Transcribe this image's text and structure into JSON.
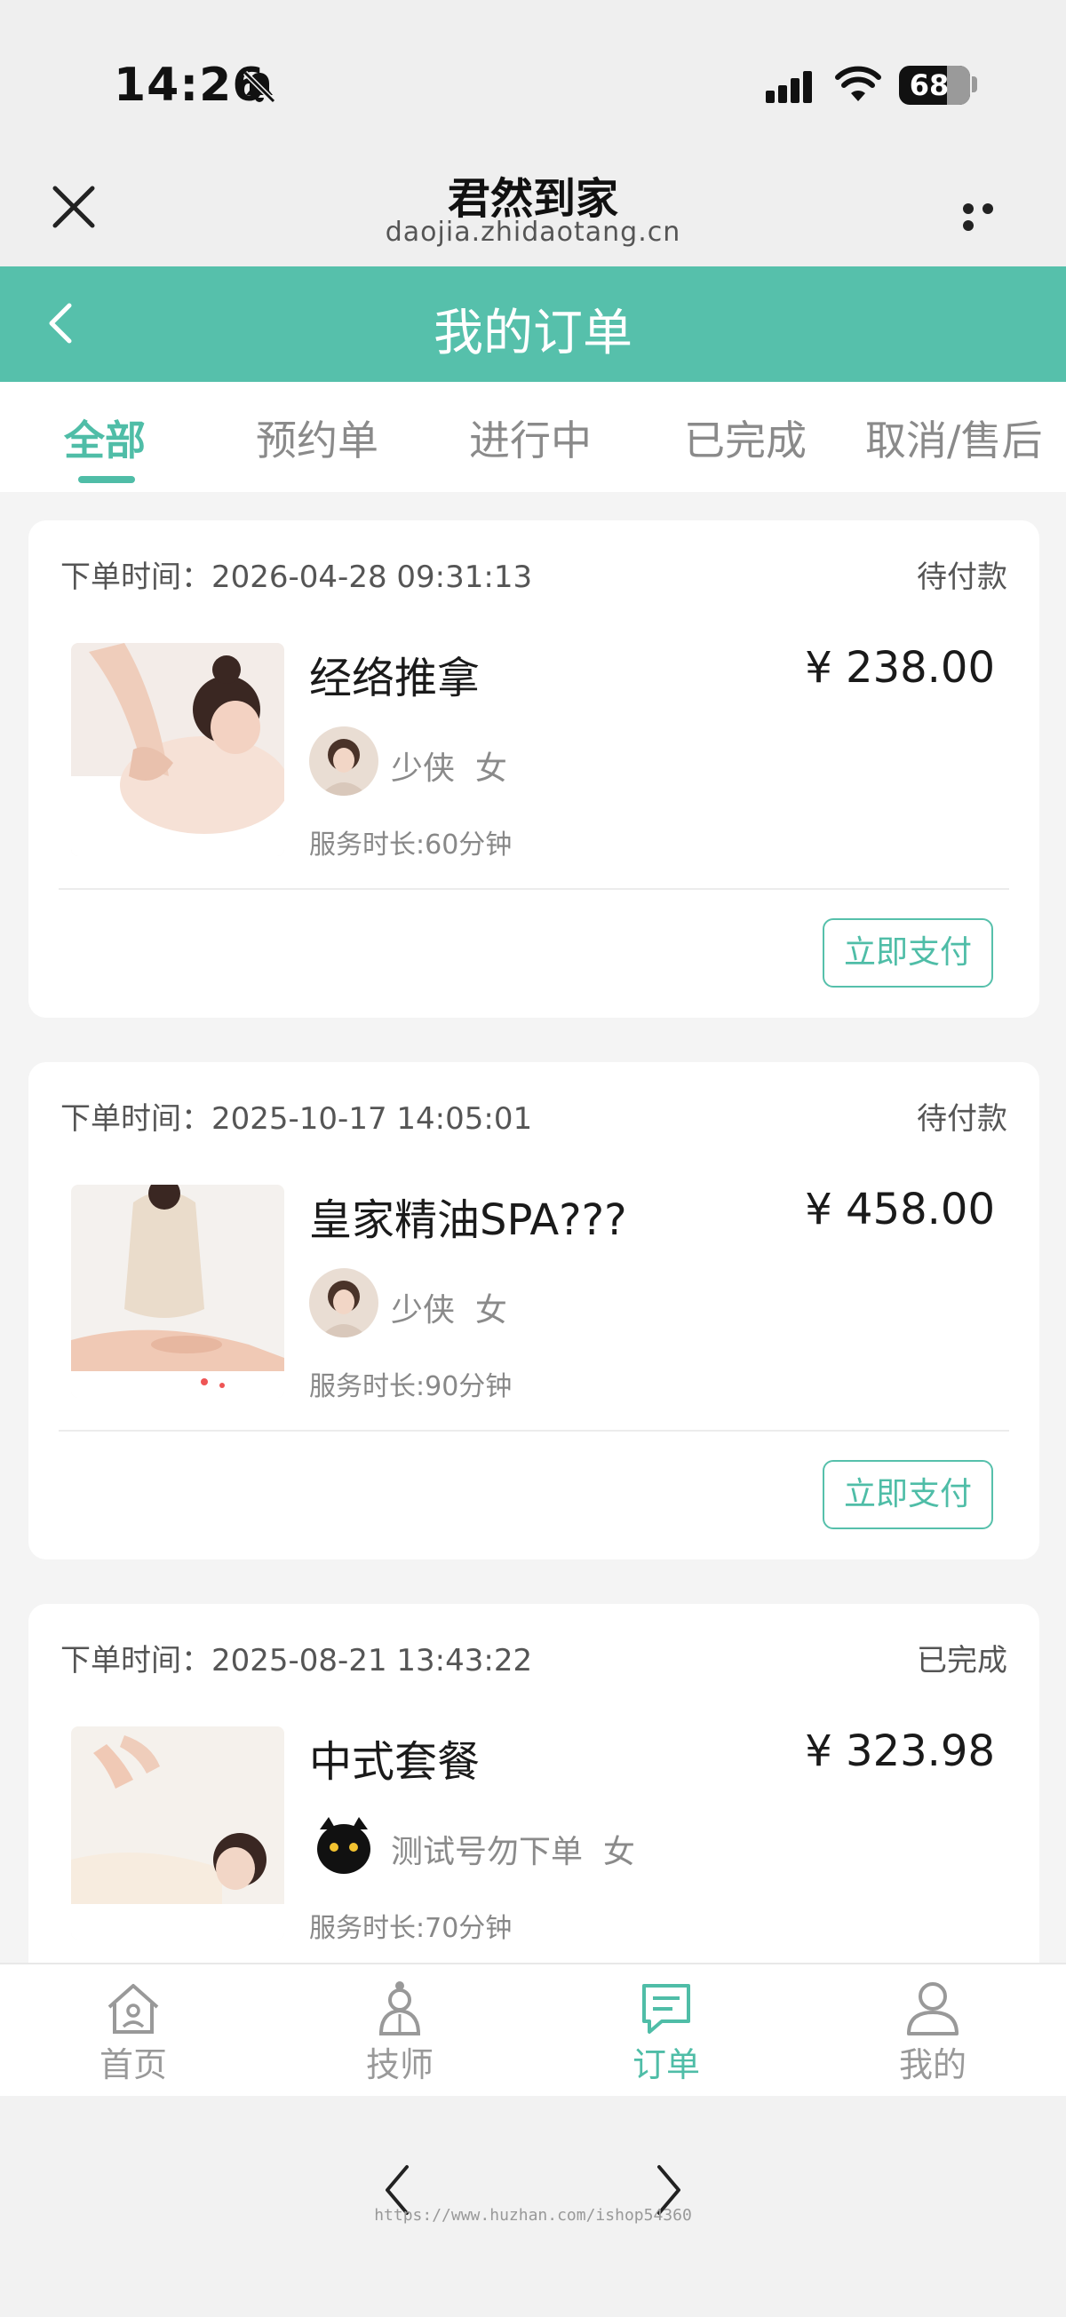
{
  "status_bar": {
    "time": "14:26",
    "battery": 68,
    "battery_label": "68",
    "icons": [
      "bell-slash-icon",
      "cellular-signal-icon",
      "wifi-icon",
      "battery-icon"
    ]
  },
  "browser": {
    "title": "君然到家",
    "url": "daojia.zhidaotang.cn",
    "close_icon": "close-icon",
    "more_icon": "more-dots-icon"
  },
  "header": {
    "title": "我的订单",
    "back_icon": "chevron-left-icon",
    "color": "#56c0ab"
  },
  "tabs": [
    {
      "label": "全部",
      "active": true
    },
    {
      "label": "预约单",
      "active": false
    },
    {
      "label": "进行中",
      "active": false
    },
    {
      "label": "已完成",
      "active": false
    },
    {
      "label": "取消/售后",
      "active": false
    }
  ],
  "orders": [
    {
      "time_label": "下单时间：",
      "time": "2026-04-28 09:31:13",
      "status": "待付款",
      "service": "经络推拿",
      "price": "¥ 238.00",
      "technician": "少侠",
      "gender": "女",
      "duration": "服务时长:60分钟",
      "action": "立即支付"
    },
    {
      "time_label": "下单时间：",
      "time": "2025-10-17 14:05:01",
      "status": "待付款",
      "service": "皇家精油SPA???",
      "price": "¥ 458.00",
      "technician": "少侠",
      "gender": "女",
      "duration": "服务时长:90分钟",
      "action": "立即支付"
    },
    {
      "time_label": "下单时间：",
      "time": "2025-08-21 13:43:22",
      "status": "已完成",
      "service": "中式套餐",
      "price": "¥ 323.98",
      "technician": "测试号勿下单",
      "gender": "女",
      "duration": "服务时长:70分钟"
    }
  ],
  "bottom_nav": [
    {
      "label": "首页",
      "icon": "home-icon",
      "active": false
    },
    {
      "label": "技师",
      "icon": "technician-icon",
      "active": false
    },
    {
      "label": "订单",
      "icon": "order-list-icon",
      "active": true
    },
    {
      "label": "我的",
      "icon": "user-icon",
      "active": false
    }
  ],
  "browser_bottom": {
    "back_icon": "chevron-left-icon",
    "forward_icon": "chevron-right-icon",
    "watermark": "https://www.huzhan.com/ishop54360"
  },
  "accent_color": "#4fbda7"
}
